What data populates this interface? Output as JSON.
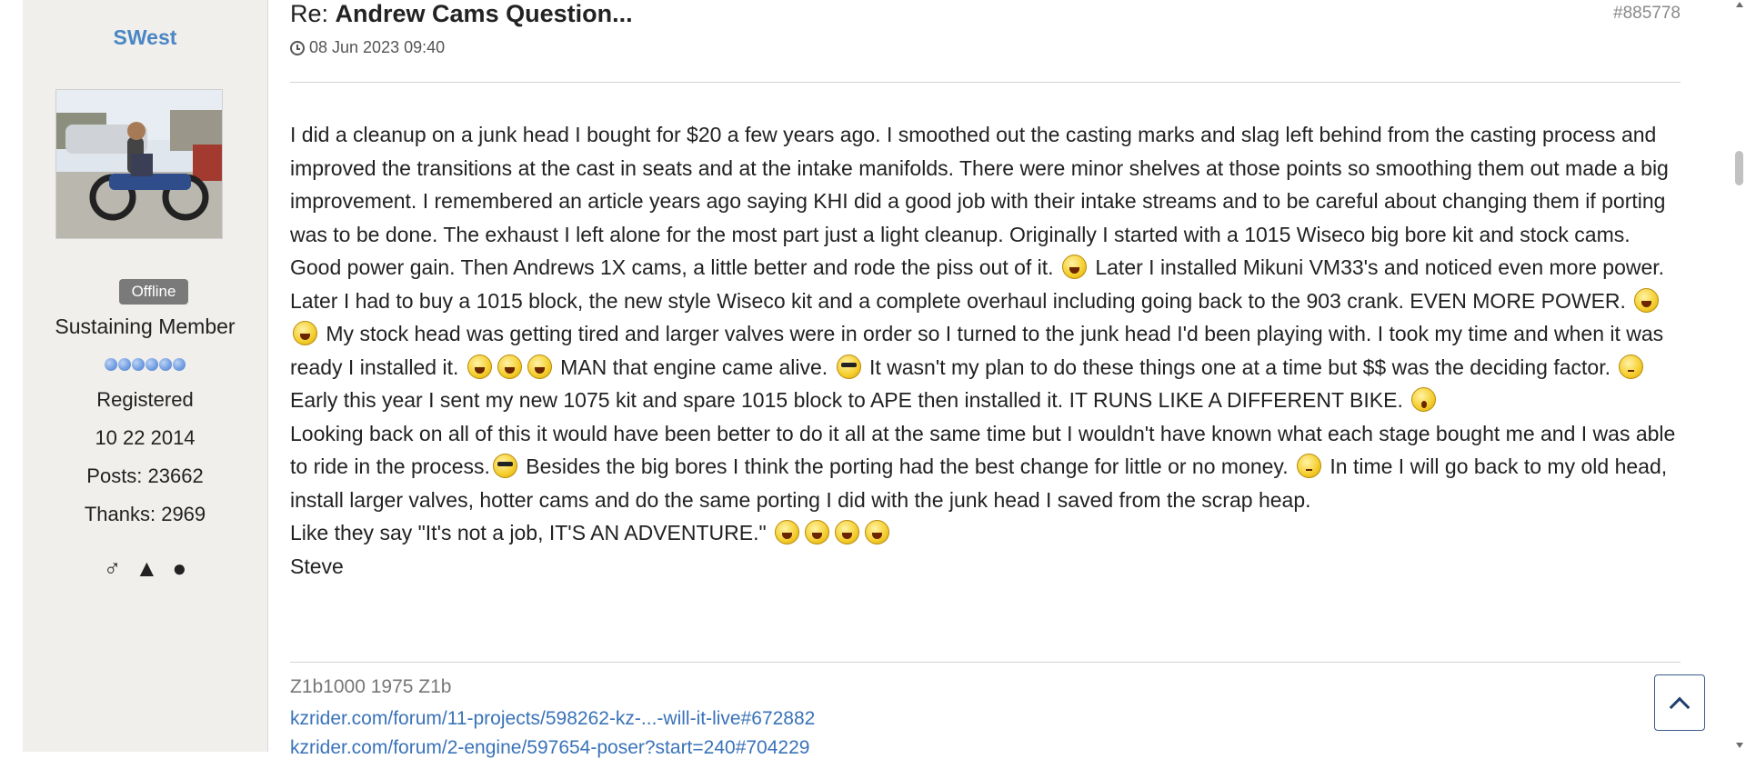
{
  "author": {
    "username": "SWest",
    "status_badge": "Offline",
    "rank": "Sustaining Member",
    "registered_label": "Registered",
    "registered_date": "10 22 2014",
    "posts": "Posts: 23662",
    "thanks": "Thanks: 2969",
    "rank_dots": 6,
    "profile_icons": [
      "male-icon",
      "birthday-cake-icon",
      "location-pin-icon"
    ],
    "profile_glyphs": [
      "♂",
      "▲",
      "●"
    ]
  },
  "post": {
    "title_prefix": "Re: ",
    "title": "Andrew Cams Question...",
    "post_id": "#885778",
    "date": "08 Jun 2023 09:40",
    "paragraphs": [
      [
        {
          "t": "I did a cleanup on a junk head I bought for $20 a few years ago. I smoothed out the casting marks and slag left behind from the casting process and improved the transitions at the cast in seats and at the intake manifolds. There were minor shelves at those points so smoothing them out made a big improvement. I remembered an article years ago saying KHI did a good job with their intake streams and to be careful about changing them if porting was to be done. The exhaust I left alone for the most part just a light cleanup. Originally I started with a 1015 Wiseco big bore kit and stock cams. Good power gain. Then Andrews 1X cams, a little better and rode the piss out of it. "
        },
        {
          "e": "laugh"
        },
        {
          "t": " Later I installed Mikuni VM33's and noticed even more power. Later I had to buy a 1015 block, the new style Wiseco kit and a complete overhaul including going back to the 903 crank. EVEN MORE POWER. "
        },
        {
          "e": "laugh"
        },
        {
          "e": "laugh"
        },
        {
          "t": " My stock head was getting tired and larger valves were in order so I turned to the junk head I'd been playing with. I took my time and when it was ready I installed it. "
        },
        {
          "e": "laugh"
        },
        {
          "e": "laugh"
        },
        {
          "e": "laugh"
        },
        {
          "t": " MAN that engine came alive. "
        },
        {
          "e": "cool"
        },
        {
          "t": " It wasn't my plan to do these things one at a time but $$ was the deciding factor. "
        },
        {
          "e": "roll"
        },
        {
          "t": " Early this year I sent my new 1075 kit and spare 1015 block to APE then installed it. IT RUNS LIKE A DIFFERENT BIKE. "
        },
        {
          "e": "shock"
        }
      ],
      [
        {
          "t": "Looking back on all of this it would have been better to do it all at the same time but I wouldn't have known what each stage bought me and I was able to ride in the process."
        },
        {
          "e": "cool"
        },
        {
          "t": " Besides the big bores I think the porting had the best change for little or no money. "
        },
        {
          "e": "roll"
        },
        {
          "t": " In time I will go back to my old head, install larger valves, hotter cams and do the same porting I did with the junk head I saved from the scrap heap."
        }
      ],
      [
        {
          "t": "Like they say \"It's not a job, IT'S AN ADVENTURE.\" "
        },
        {
          "e": "laugh"
        },
        {
          "e": "laugh"
        },
        {
          "e": "laugh"
        },
        {
          "e": "laugh"
        }
      ],
      [
        {
          "t": "Steve"
        }
      ]
    ]
  },
  "signature": {
    "bike": "Z1b1000 1975 Z1b",
    "links": [
      "kzrider.com/forum/11-projects/598262-kz-...-will-it-live#672882",
      "kzrider.com/forum/2-engine/597654-poser?start=240#704229"
    ]
  },
  "colors": {
    "username": "#4a86c4",
    "link": "#3a73b8",
    "sidebar_bg": "#f0efec",
    "badge_bg": "#7a7a7a"
  }
}
